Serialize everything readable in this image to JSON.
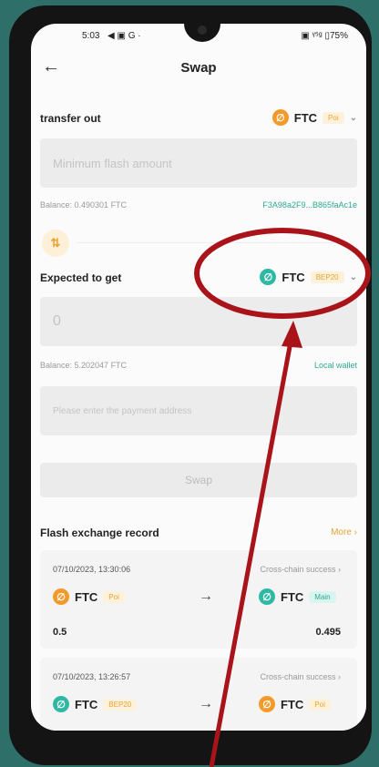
{
  "status_bar": {
    "time": "5:03",
    "signal_icons": "◀ ▣ G ·",
    "battery": "▣ ᵞ⁵ᵍ ▯75%"
  },
  "header": {
    "title": "Swap",
    "back_icon": "←"
  },
  "transfer_out": {
    "label": "transfer out",
    "coin": "FTC",
    "coin_icon_glyph": "∅",
    "tag": "Poi",
    "input_placeholder": "Minimum flash amount",
    "balance": "Balance: 0.490301 FTC",
    "address": "F3A98a2F9...B865faAc1e"
  },
  "swap_icon_glyph": "⇅",
  "expected": {
    "label": "Expected to get",
    "coin": "FTC",
    "coin_icon_glyph": "∅",
    "tag": "BEP20",
    "value": "0",
    "balance": "Balance: 5.202047 FTC",
    "wallet": "Local wallet",
    "address_placeholder": "Please enter the payment address"
  },
  "swap_button": "Swap",
  "records": {
    "title": "Flash exchange record",
    "more": "More ›",
    "items": [
      {
        "date": "07/10/2023, 13:30:06",
        "status": "Cross-chain success ›",
        "from_coin": "FTC",
        "from_tag": "Poi",
        "to_coin": "FTC",
        "to_tag": "Main",
        "from_amount": "0.5",
        "to_amount": "0.495"
      },
      {
        "date": "07/10/2023, 13:26:57",
        "status": "Cross-chain success ›",
        "from_coin": "FTC",
        "from_tag": "BEP20",
        "to_coin": "FTC",
        "to_tag": "Poi"
      }
    ]
  },
  "arrow_glyph": "→",
  "chevron_glyph": "⌄",
  "colors": {
    "accent_teal": "#2fb9a5",
    "accent_orange": "#f39a2b",
    "annotation_red": "#a8141a"
  }
}
